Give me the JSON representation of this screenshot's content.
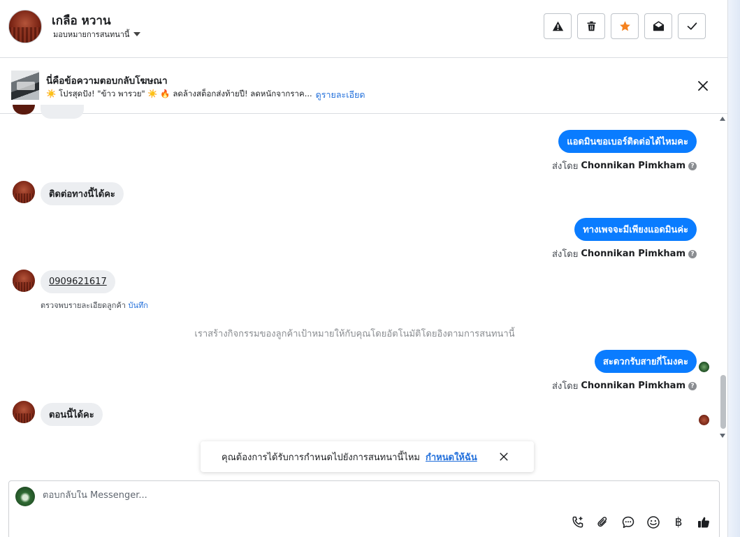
{
  "header": {
    "contact_name": "เกลือ หวาน",
    "assign_label": "มอบหมายการสนทนานี้"
  },
  "ad_banner": {
    "title": "นี่คือข้อความตอบกลับโฆษณา",
    "text": "☀️ โปรสุดปัง! \"ข้าว พารวย\" ☀️ 🔥 ลดล้างสต็อกส่งท้ายปี! ลดหนักจากราค...",
    "link": "ดูรายละเอียด"
  },
  "messages": {
    "out_1": "แอดมินขอเบอร์ติดต่อได้ไหมคะ",
    "in_1": "ติดต่อทางนี้ได้คะ",
    "out_2": "ทางเพจจะมีเพียงแอดมินค่ะ",
    "in_phone": "0909621617",
    "detect_text": "ตรวจพบรายละเอียดลูกค้า",
    "detect_link": "บันทึก",
    "system_note": "เราสร้างกิจกรรมของลูกค้าเป้าหมายให้กับคุณโดยอัตโนมัติโดยอิงตามการสนทนานี้",
    "out_3": "สะดวกรับสายกี่โมงคะ",
    "in_2": "ตอนนี้ได้คะ",
    "sent_by_prefix": "ส่งโดย",
    "sender_name": "Chonnikan Pimkham",
    "help_glyph": "?"
  },
  "toast": {
    "text": "คุณต้องการได้รับการกำหนดไปยังการสนทนานี้ไหม",
    "link": "กำหนดให้ฉัน"
  },
  "composer": {
    "placeholder": "ตอบกลับใน Messenger...",
    "baht_symbol": "฿"
  },
  "icons": {
    "header_buttons": [
      "warning-icon",
      "trash-icon",
      "star-icon",
      "mail-open-icon",
      "check-icon"
    ],
    "composer_tools": [
      "phone-plus-icon",
      "paperclip-icon",
      "chat-bubble-icon",
      "emoji-icon",
      "baht-icon",
      "thumbs-up-icon"
    ]
  },
  "colors": {
    "accent_blue": "#0a7cff",
    "link_blue": "#216fdb",
    "star_orange": "#f5821f"
  }
}
